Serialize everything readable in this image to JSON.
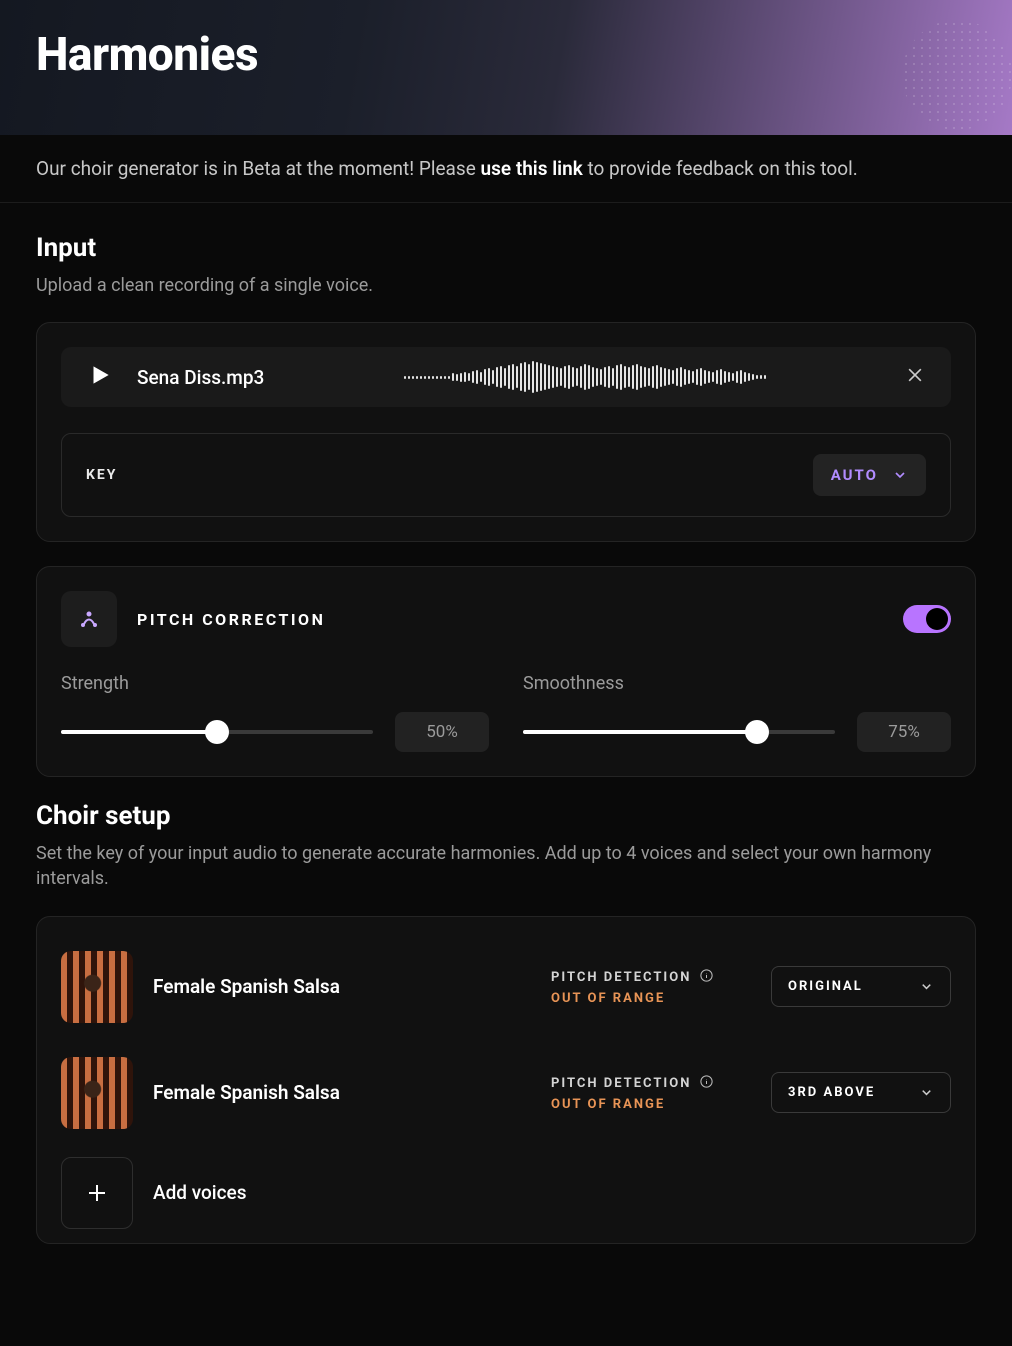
{
  "hero": {
    "title": "Harmonies"
  },
  "banner": {
    "prefix": "Our choir generator is in Beta at the moment! Please ",
    "link": "use this link",
    "suffix": " to provide feedback on this tool."
  },
  "input": {
    "title": "Input",
    "desc": "Upload a clean recording of a single voice.",
    "filename": "Sena Diss.mp3",
    "key_label": "KEY",
    "key_value": "AUTO"
  },
  "pitch": {
    "title": "PITCH CORRECTION",
    "enabled": true,
    "strength": {
      "label": "Strength",
      "value": 50,
      "display": "50%"
    },
    "smoothness": {
      "label": "Smoothness",
      "value": 75,
      "display": "75%"
    }
  },
  "choir": {
    "title": "Choir setup",
    "desc": "Set the key of your input audio to generate accurate harmonies. Add up to 4 voices and select your own harmony intervals.",
    "pd_label": "PITCH DETECTION",
    "voices": [
      {
        "name": "Female Spanish Salsa",
        "status": "OUT OF RANGE",
        "interval": "ORIGINAL"
      },
      {
        "name": "Female Spanish Salsa",
        "status": "OUT OF RANGE",
        "interval": "3RD ABOVE"
      }
    ],
    "add_label": "Add voices"
  }
}
